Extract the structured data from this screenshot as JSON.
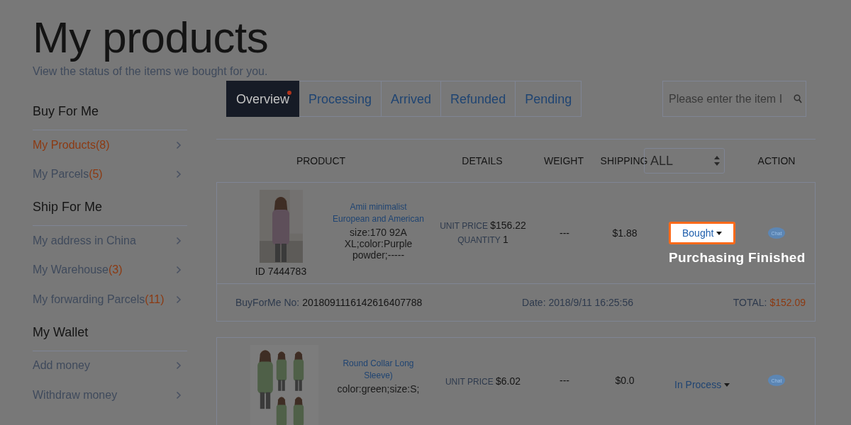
{
  "header": {
    "title": "My products",
    "subtitle": "View the status of the items we bought for you."
  },
  "sidebar": {
    "sections": [
      {
        "title": "Buy For Me",
        "items": [
          {
            "label": "My Products",
            "count": "(8)",
            "selected": true
          },
          {
            "label": "My Parcels",
            "count": "(5)",
            "selected": false
          }
        ]
      },
      {
        "title": "Ship For Me",
        "items": [
          {
            "label": "My address in China",
            "selected": false
          },
          {
            "label": "My Warehouse",
            "count": "(3)",
            "selected": false
          },
          {
            "label": "My forwarding Parcels",
            "count": "(11)",
            "selected": false
          }
        ]
      },
      {
        "title": "My Wallet",
        "items": [
          {
            "label": "Add money",
            "selected": false
          },
          {
            "label": "Withdraw money",
            "selected": false
          }
        ]
      }
    ]
  },
  "tabs": [
    {
      "label": "Overview",
      "selected": true,
      "badge": true
    },
    {
      "label": "Processing",
      "selected": false,
      "badge": false
    },
    {
      "label": "Arrived",
      "selected": false,
      "badge": false
    },
    {
      "label": "Refunded",
      "selected": false,
      "badge": false
    },
    {
      "label": "Pending",
      "selected": false,
      "badge": false
    }
  ],
  "search": {
    "placeholder": "Please enter the item I"
  },
  "table": {
    "columns": [
      "PRODUCT",
      "DETAILS",
      "WEIGHT",
      "SHIPPING"
    ],
    "filter": {
      "value": "ALL"
    },
    "action_column": "ACTION"
  },
  "orders": [
    {
      "picture": {
        "kind": "single"
      },
      "product_id": "ID 7444783",
      "name": "Amii minimalist European and American",
      "options": "size:170 92A XL;color:Purple powder;-----",
      "unit_price_label": "UNIT PRICE",
      "unit_price": "$156.22",
      "quantity_label": "QUANTITY",
      "quantity": "1",
      "weight": "---",
      "shipping": "$1.88",
      "status": "Bought",
      "highlighted": true,
      "note": "Purchasing Finished",
      "chat": "Chat",
      "footer": {
        "order_no_label": "BuyForMe No:",
        "order_no": "2018091116142616407788",
        "date": "Date: 2018/9/11 16:25:56",
        "total_label": "TOTAL:",
        "total": "$152.09"
      }
    },
    {
      "picture": {
        "kind": "collage"
      },
      "name": "Round Collar Long Sleeve)",
      "options": "color:green;size:S;",
      "unit_price_label": "UNIT PRICE",
      "unit_price": "$6.02",
      "weight": "---",
      "shipping": "$0.0",
      "status": "In Process",
      "highlighted": false,
      "chat": "Chat"
    }
  ]
}
